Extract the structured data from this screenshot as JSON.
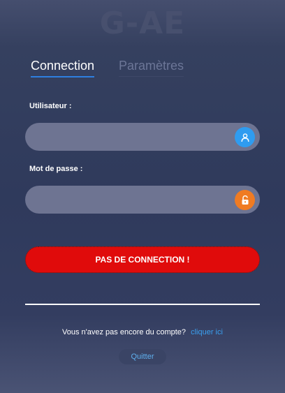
{
  "app": {
    "title": "G-AE"
  },
  "tabs": [
    {
      "label": "Connection",
      "active": true
    },
    {
      "label": "Paramètres",
      "active": false
    }
  ],
  "form": {
    "username_label": "Utilisateur :",
    "username_value": "",
    "password_label": "Mot de passe :",
    "password_value": "",
    "username_icon": "user-icon",
    "password_icon": "lock-icon"
  },
  "status_button": {
    "label": "PAS DE CONNECTION !",
    "color": "#e00b0b"
  },
  "signup": {
    "text": "Vous n'avez pas encore du compte?",
    "link": "cliquer ici"
  },
  "quit_label": "Quitter",
  "colors": {
    "accent": "#2e7fe0",
    "link": "#3aa0f0",
    "user_icon_bg": "#2f9cf0",
    "lock_icon_bg": "#f07b22"
  }
}
